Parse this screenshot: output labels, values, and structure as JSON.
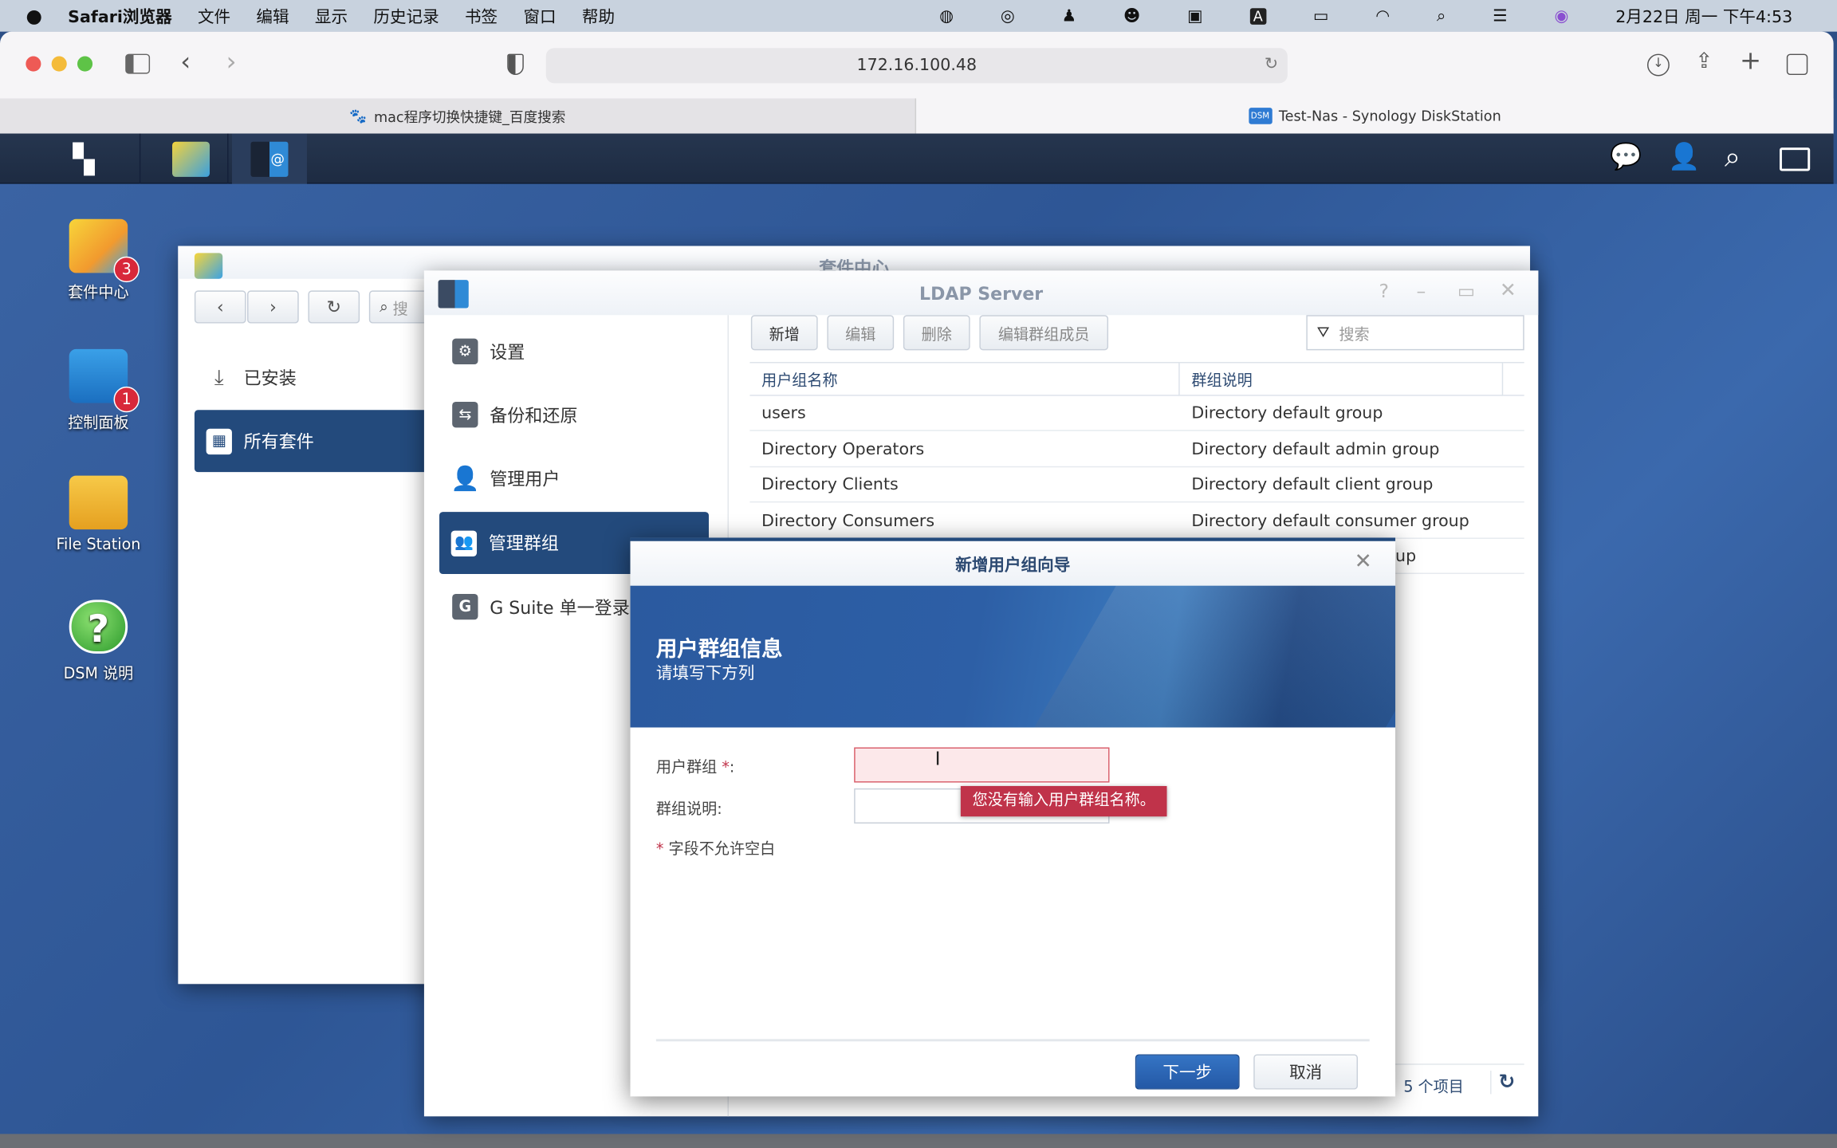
{
  "menubar": {
    "apple": "",
    "app": "Safari浏览器",
    "items": [
      "文件",
      "编辑",
      "显示",
      "历史记录",
      "书签",
      "窗口",
      "帮助"
    ],
    "clock": "2月22日 周一 下午4:53"
  },
  "safari": {
    "url": "172.16.100.48",
    "tabs": [
      {
        "label": "mac程序切换快捷键_百度搜索",
        "active": false
      },
      {
        "label": "Test-Nas - Synology DiskStation",
        "active": true
      }
    ]
  },
  "desktop": {
    "icons": [
      {
        "label": "套件中心",
        "badge": "3"
      },
      {
        "label": "控制面板",
        "badge": "1"
      },
      {
        "label": "File Station"
      },
      {
        "label": "DSM 说明"
      }
    ]
  },
  "package_center": {
    "title": "套件中心",
    "search_placeholder": "搜",
    "nav": [
      {
        "label": "已安装"
      },
      {
        "label": "所有套件",
        "selected": true
      }
    ]
  },
  "ldap": {
    "title": "LDAP Server",
    "sidebar": [
      {
        "label": "设置",
        "icon": "gear-icon"
      },
      {
        "label": "备份和还原",
        "icon": "backup-icon"
      },
      {
        "label": "管理用户",
        "icon": "user-icon"
      },
      {
        "label": "管理群组",
        "icon": "group-icon",
        "selected": true
      },
      {
        "label": "G Suite 单一登录",
        "icon": "gsuite-icon"
      }
    ],
    "toolbar": {
      "add": "新增",
      "edit": "编辑",
      "delete": "删除",
      "edit_members": "编辑群组成员",
      "search_placeholder": "搜索"
    },
    "table": {
      "columns": [
        "用户组名称",
        "群组说明"
      ],
      "rows": [
        [
          "users",
          "Directory default group"
        ],
        [
          "Directory Operators",
          "Directory default admin group"
        ],
        [
          "Directory Clients",
          "Directory default client group"
        ],
        [
          "Directory Consumers",
          "Directory default consumer group"
        ]
      ],
      "partial_row_tail": "up"
    },
    "footer": {
      "count": "5 个项目"
    }
  },
  "dialog": {
    "title": "新增用户组向导",
    "banner_title": "用户群组信息",
    "banner_subtitle": "请填写下方列",
    "group_label": "用户群组",
    "required_mark": "*",
    "colon": ":",
    "desc_label": "群组说明:",
    "group_value": "",
    "desc_value": "",
    "error_tooltip": "您没有输入用户群组名称。",
    "required_note": "字段不允许空白",
    "next": "下一步",
    "cancel": "取消"
  },
  "colors": {
    "accent": "#234a7c",
    "error": "#c0334a",
    "error_bg": "#fce8ea",
    "primary_button": "#2a62b0"
  }
}
